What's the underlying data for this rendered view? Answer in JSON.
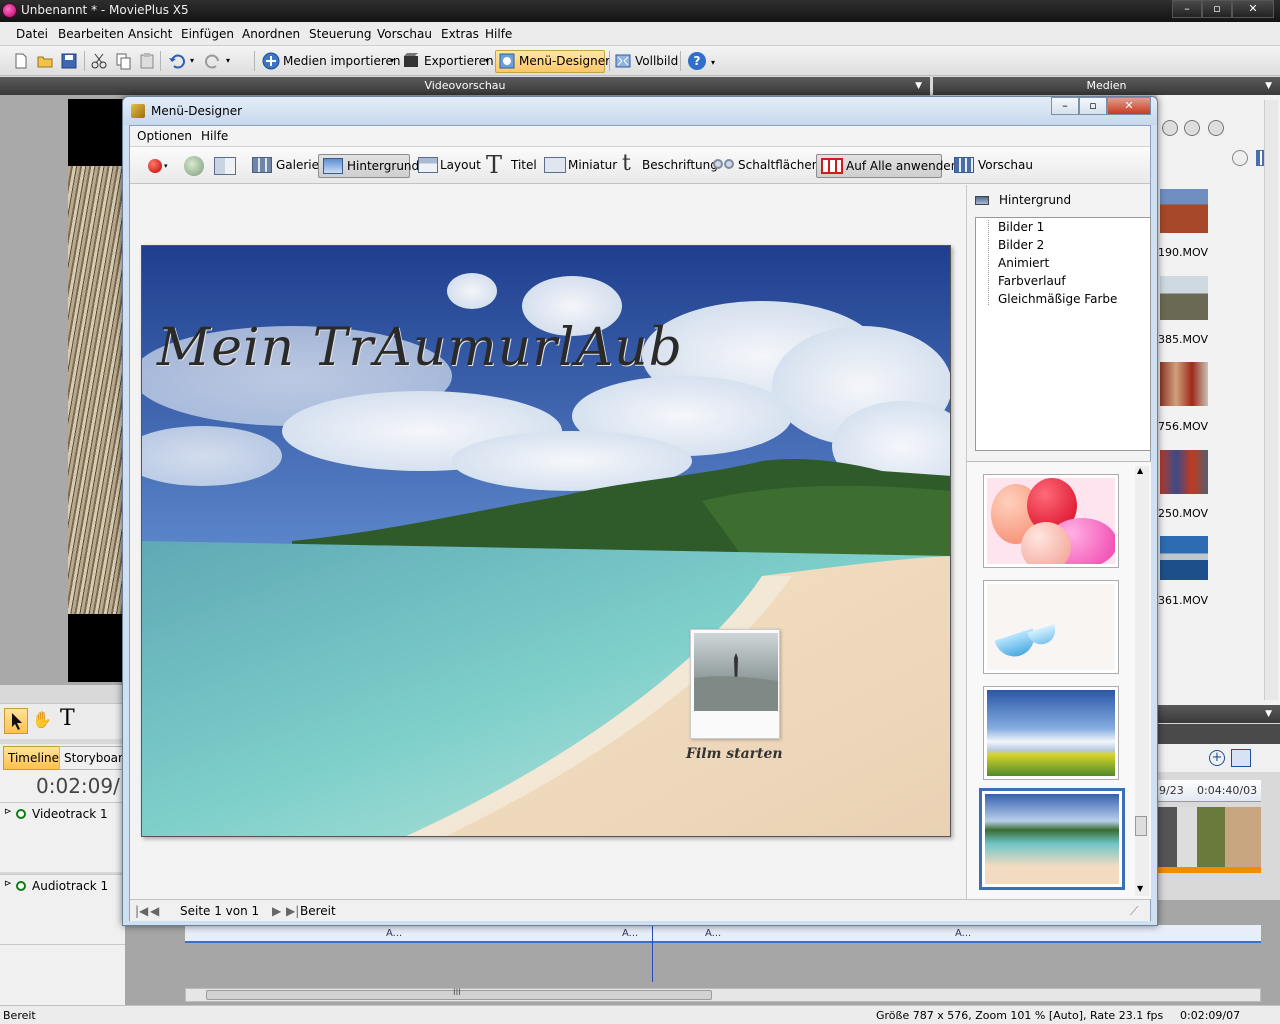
{
  "app": {
    "title": "Unbenannt * - MoviePlus X5",
    "window_controls": [
      "–",
      "▫",
      "✕"
    ]
  },
  "menubar": {
    "items": [
      "Datei",
      "Bearbeiten",
      "Ansicht",
      "Einfügen",
      "Anordnen",
      "Steuerung",
      "Vorschau",
      "Extras",
      "Hilfe"
    ]
  },
  "toolbar": {
    "import_label": "Medien importieren",
    "export_label": "Exportieren",
    "menu_designer_label": "Menü-Designer",
    "fullscreen_label": "Vollbild",
    "help_icon": "?"
  },
  "panels": {
    "video_preview_title": "Videovorschau",
    "media_title": "Medien"
  },
  "left": {
    "tabs": [
      "Timeline",
      "Storyboard"
    ],
    "timecode": "0:02:09/",
    "tracks": [
      "Videotrack 1",
      "Audiotrack 1"
    ]
  },
  "media": {
    "files": [
      "190.MOV",
      "385.MOV",
      "756.MOV",
      "250.MOV",
      "361.MOV"
    ],
    "timeline_markers": [
      "9/23",
      "0:04:40/03"
    ]
  },
  "timeline": {
    "audio_markers": [
      "A...",
      "A...",
      "A...",
      "A..."
    ],
    "scroll_grip": "III"
  },
  "statusbar": {
    "left": "Bereit",
    "info": "Größe 787 x 576, Zoom 101 % [Auto], Rate 23.1 fps",
    "time": "0:02:09/07"
  },
  "dialog": {
    "title": "Menü-Designer",
    "window_controls": [
      "–",
      "▫",
      "✕"
    ],
    "menu": [
      "Optionen",
      "Hilfe"
    ],
    "toolbar": {
      "gallery": "Galerie",
      "background": "Hintergrund",
      "layout": "Layout",
      "title": "Titel",
      "thumbnail": "Miniatur",
      "caption": "Beschriftung",
      "buttons": "Schaltflächen",
      "apply_all": "Auf Alle anwenden",
      "preview": "Vorschau"
    },
    "canvas": {
      "title_text": "Mein TrAumurlAub",
      "button_label": "Film starten"
    },
    "panel": {
      "header": "Hintergrund",
      "tree": [
        "Bilder 1",
        "Bilder 2",
        "Animiert",
        "Farbverlauf",
        "Gleichmäßige Farbe"
      ]
    },
    "status": {
      "page": "Seite 1 von 1",
      "state": "Bereit"
    }
  },
  "colors": {
    "accent_selected": "#ffc766",
    "selection_blue": "#3a6fb4",
    "titlebar_dark": "#1e1e1e"
  }
}
